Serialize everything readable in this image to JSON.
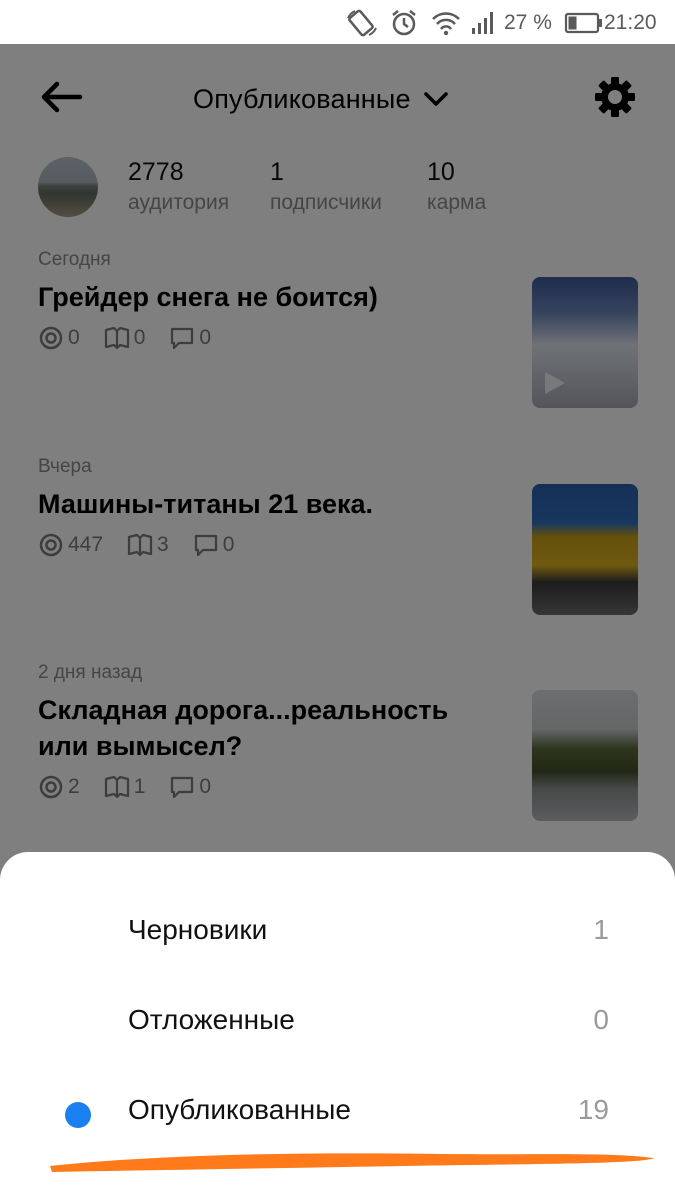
{
  "status_bar": {
    "battery_percent": "27 %",
    "time": "21:20"
  },
  "header": {
    "title": "Опубликованные"
  },
  "profile": {
    "stats": [
      {
        "value": "2778",
        "label": "аудитория"
      },
      {
        "value": "1",
        "label": "подписчики"
      },
      {
        "value": "10",
        "label": "карма"
      }
    ]
  },
  "articles": [
    {
      "date": "Сегодня",
      "title": "Грейдер снега не боится)",
      "views": "0",
      "reads": "0",
      "comments": "0"
    },
    {
      "date": "Вчера",
      "title": "Машины-титаны 21 века.",
      "views": "447",
      "reads": "3",
      "comments": "0"
    },
    {
      "date": "2 дня назад",
      "title": "Складная дорога...реальность или вымысел?",
      "views": "2",
      "reads": "1",
      "comments": "0"
    }
  ],
  "sheet": {
    "items": [
      {
        "label": "Черновики",
        "count": "1",
        "selected": false
      },
      {
        "label": "Отложенные",
        "count": "0",
        "selected": false
      },
      {
        "label": "Опубликованные",
        "count": "19",
        "selected": true
      }
    ]
  },
  "colors": {
    "accent": "#1a7ff0",
    "annotation": "#ff7a1a",
    "overlay": "rgba(0,0,0,0.5)"
  }
}
